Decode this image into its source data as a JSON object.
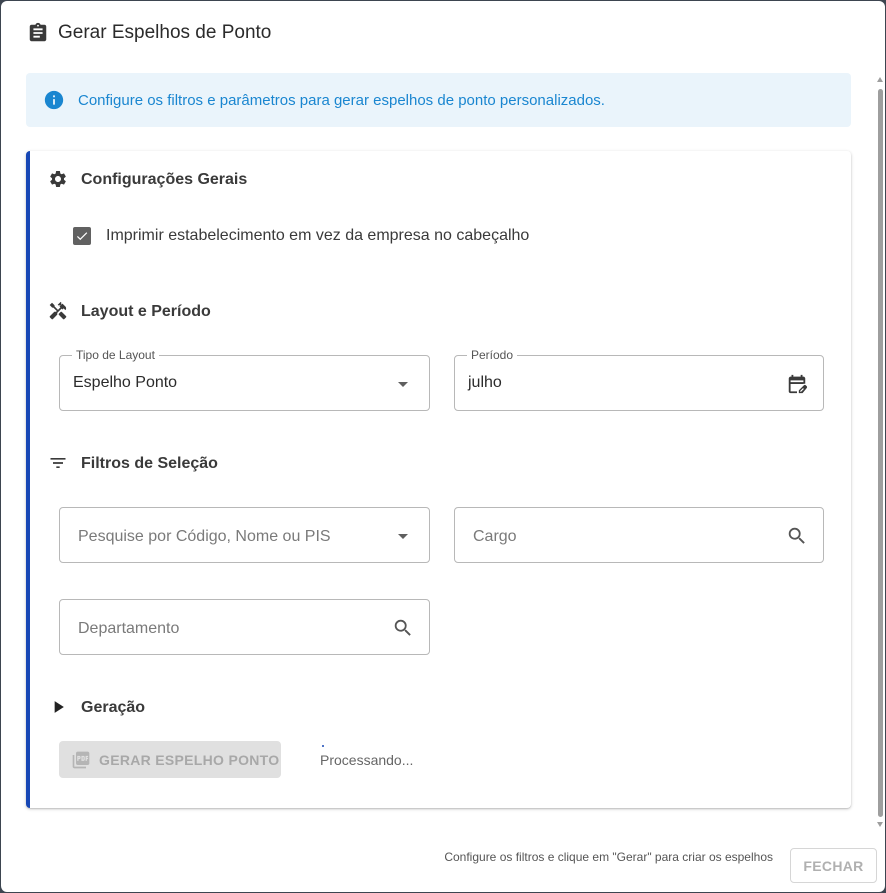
{
  "dialog": {
    "title": "Gerar Espelhos de Ponto",
    "title_icon": "clipboard-icon"
  },
  "info": {
    "text": "Configure os filtros e parâmetros para gerar espelhos de ponto personalizados.",
    "icon": "info-icon",
    "color": "#1a86d0"
  },
  "sections": {
    "general": {
      "label": "Configurações Gerais",
      "icon": "gear-icon"
    },
    "layout": {
      "label": "Layout e Período",
      "icon": "tools-icon"
    },
    "filters": {
      "label": "Filtros de Seleção",
      "icon": "filter-list-icon"
    },
    "generation": {
      "label": "Geração",
      "icon": "caret-right-icon"
    }
  },
  "options": {
    "print_establishment": {
      "label": "Imprimir estabelecimento em vez da empresa no cabeçalho",
      "checked": true
    }
  },
  "layout_fields": {
    "layout_type": {
      "legend": "Tipo de Layout",
      "value": "Espelho Ponto"
    },
    "period": {
      "legend": "Período",
      "value": "julho"
    }
  },
  "filter_fields": {
    "employee": {
      "placeholder": "Pesquise por Código, Nome ou PIS"
    },
    "position": {
      "placeholder": "Cargo"
    },
    "department": {
      "placeholder": "Departamento"
    }
  },
  "generation": {
    "button_label": "GERAR ESPELHO PONTO",
    "status": "Processando..."
  },
  "footer": {
    "hint": "Configure os filtros e clique em \"Gerar\" para criar os espelhos",
    "close_label": "FECHAR"
  },
  "colors": {
    "accent": "#1747b5",
    "info_bg": "#eaf4fb"
  }
}
